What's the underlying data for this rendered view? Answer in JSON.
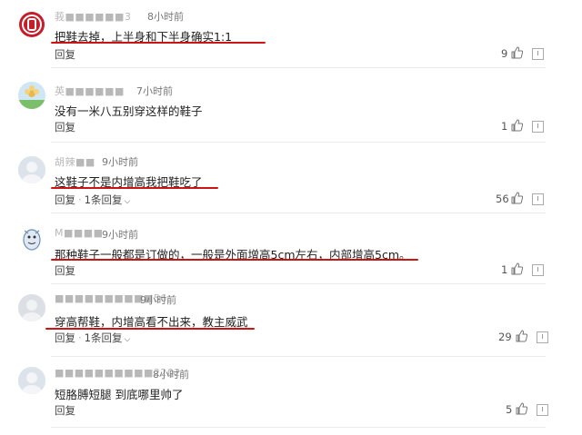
{
  "comments": [
    {
      "name": "莪■■■■■■3",
      "time": "8小时前",
      "text": "把鞋去掉，上半身和下半身确实1:1",
      "actions": {
        "reply": "回复",
        "more_replies": ""
      },
      "likes": "9"
    },
    {
      "name": "英■■■■■■",
      "time": "7小时前",
      "text": "没有一米八五别穿这样的鞋子",
      "actions": {
        "reply": "回复",
        "more_replies": ""
      },
      "likes": "1"
    },
    {
      "name": "胡辣■■",
      "time": "9小时前",
      "text": "这鞋子不是内增高我把鞋吃了",
      "actions": {
        "reply": "回复",
        "more_replies": "1条回复"
      },
      "likes": "56"
    },
    {
      "name": "M■■■■",
      "time": "9小时前",
      "text": "那种鞋子一般都是订做的，一般是外面增高5cm左右，内部增高5cm。",
      "actions": {
        "reply": "回复",
        "more_replies": ""
      },
      "likes": "1"
    },
    {
      "name": "■■■■■■■■■■56",
      "time": "9小时前",
      "text": "穿高帮鞋，内增高看不出来，教主威武",
      "actions": {
        "reply": "回复",
        "more_replies": "1条回复"
      },
      "likes": "29"
    },
    {
      "name": "■■■■■■■■■■2202",
      "time": "8小时前",
      "text": "短胳膊短腿 到底哪里帅了",
      "actions": {
        "reply": "回复",
        "more_replies": ""
      },
      "likes": "5"
    }
  ],
  "colors": {
    "underline": "#cc1414",
    "avatar_logo": "#c41e2a"
  },
  "icons": [
    "logo-avatar-icon",
    "flower-avatar-icon",
    "default-avatar-icon",
    "cartoon-avatar-icon",
    "thumbs-up-icon",
    "report-icon",
    "chevron-down-icon"
  ]
}
